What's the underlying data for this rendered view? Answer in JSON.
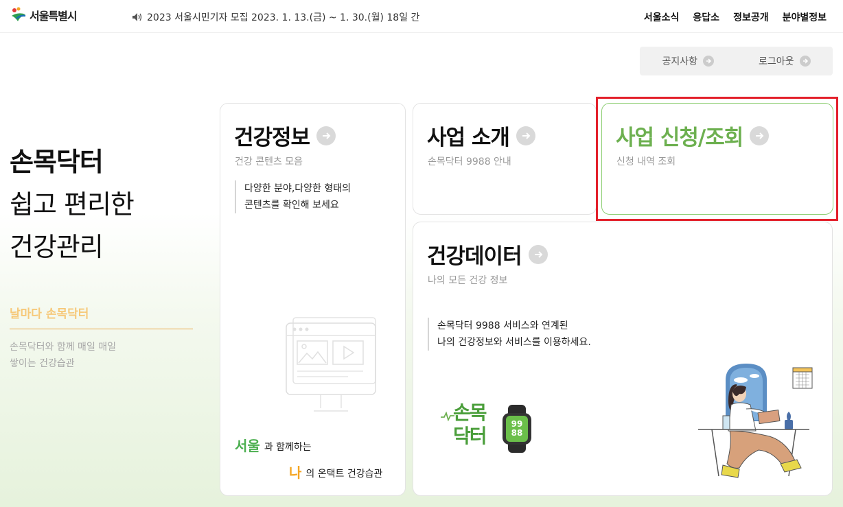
{
  "header": {
    "logo_text": "서울특별시",
    "notice": "2023 서울시민기자 모집 2023. 1. 13.(금) ~ 1. 30.(월) 18일 간",
    "nav": [
      "서울소식",
      "응답소",
      "정보공개",
      "분야별정보"
    ]
  },
  "util": {
    "notice_label": "공지사항",
    "logout_label": "로그아웃"
  },
  "hero": {
    "line1": "손목닥터",
    "line2": "쉽고 편리한",
    "line3": "건강관리",
    "sub": "날마다 손목닥터",
    "desc1": "손목닥터와 함께 매일 매일",
    "desc2": "쌓이는 건강습관"
  },
  "cards": {
    "health_info": {
      "title": "건강정보",
      "sub": "건강 콘텐츠 모음",
      "quote1": "다양한 분야,다양한 형태의",
      "quote2": "콘텐츠를 확인해 보세요",
      "seoul_big": "서울",
      "seoul_small": "과 함께하는",
      "na_big": "나",
      "na_small": "의 온택트 건강습관"
    },
    "intro": {
      "title": "사업 소개",
      "sub": "손목닥터 9988 안내"
    },
    "apply": {
      "title": "사업 신청/조회",
      "sub": "신청 내역 조회"
    },
    "data": {
      "title": "건강데이터",
      "sub": "나의 모든 건강 정보",
      "quote1": "손목닥터 9988 서비스와 연계된",
      "quote2": "나의 건강정보와 서비스를 이용하세요.",
      "logo_line1": "손목",
      "logo_line2": "닥터",
      "watch_top": "99",
      "watch_bottom": "88"
    }
  },
  "colors": {
    "accent_green": "#6db050",
    "highlight_red": "#e3202b",
    "orange": "#e8a640"
  }
}
